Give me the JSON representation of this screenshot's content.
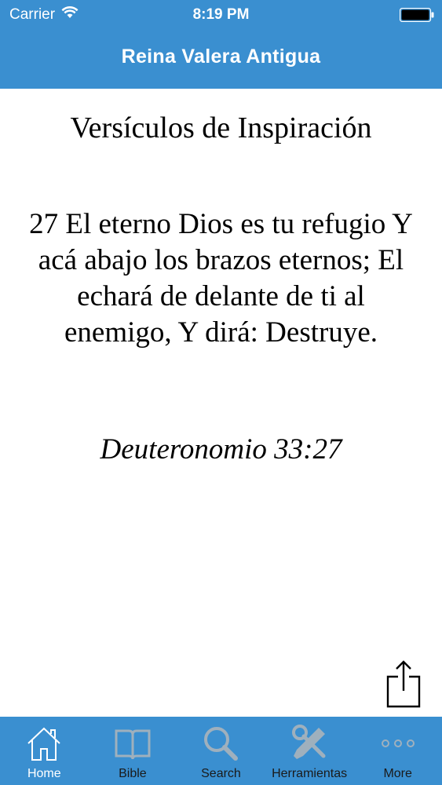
{
  "status_bar": {
    "carrier": "Carrier",
    "time": "8:19 PM"
  },
  "nav": {
    "title": "Reina Valera Antigua"
  },
  "content": {
    "section_title": "Versículos de Inspiración",
    "verse_text": "27 El eterno Dios es tu refugio Y acá abajo los brazos eternos; El echará de delante de ti al enemigo, Y dirá: Destruye.",
    "verse_reference": "Deuteronomio 33:27"
  },
  "tab_bar": {
    "tabs": [
      {
        "label": "Home",
        "icon": "home-icon",
        "active": true
      },
      {
        "label": "Bible",
        "icon": "book-icon",
        "active": false
      },
      {
        "label": "Search",
        "icon": "search-icon",
        "active": false
      },
      {
        "label": "Herramientas",
        "icon": "tools-icon",
        "active": false
      },
      {
        "label": "More",
        "icon": "more-icon",
        "active": false
      }
    ]
  },
  "colors": {
    "bar_background": "#3a8fd0",
    "active_tab": "#ffffff",
    "inactive_tab_icon": "#9fb0bd",
    "inactive_tab_label": "#1a1a1a"
  }
}
